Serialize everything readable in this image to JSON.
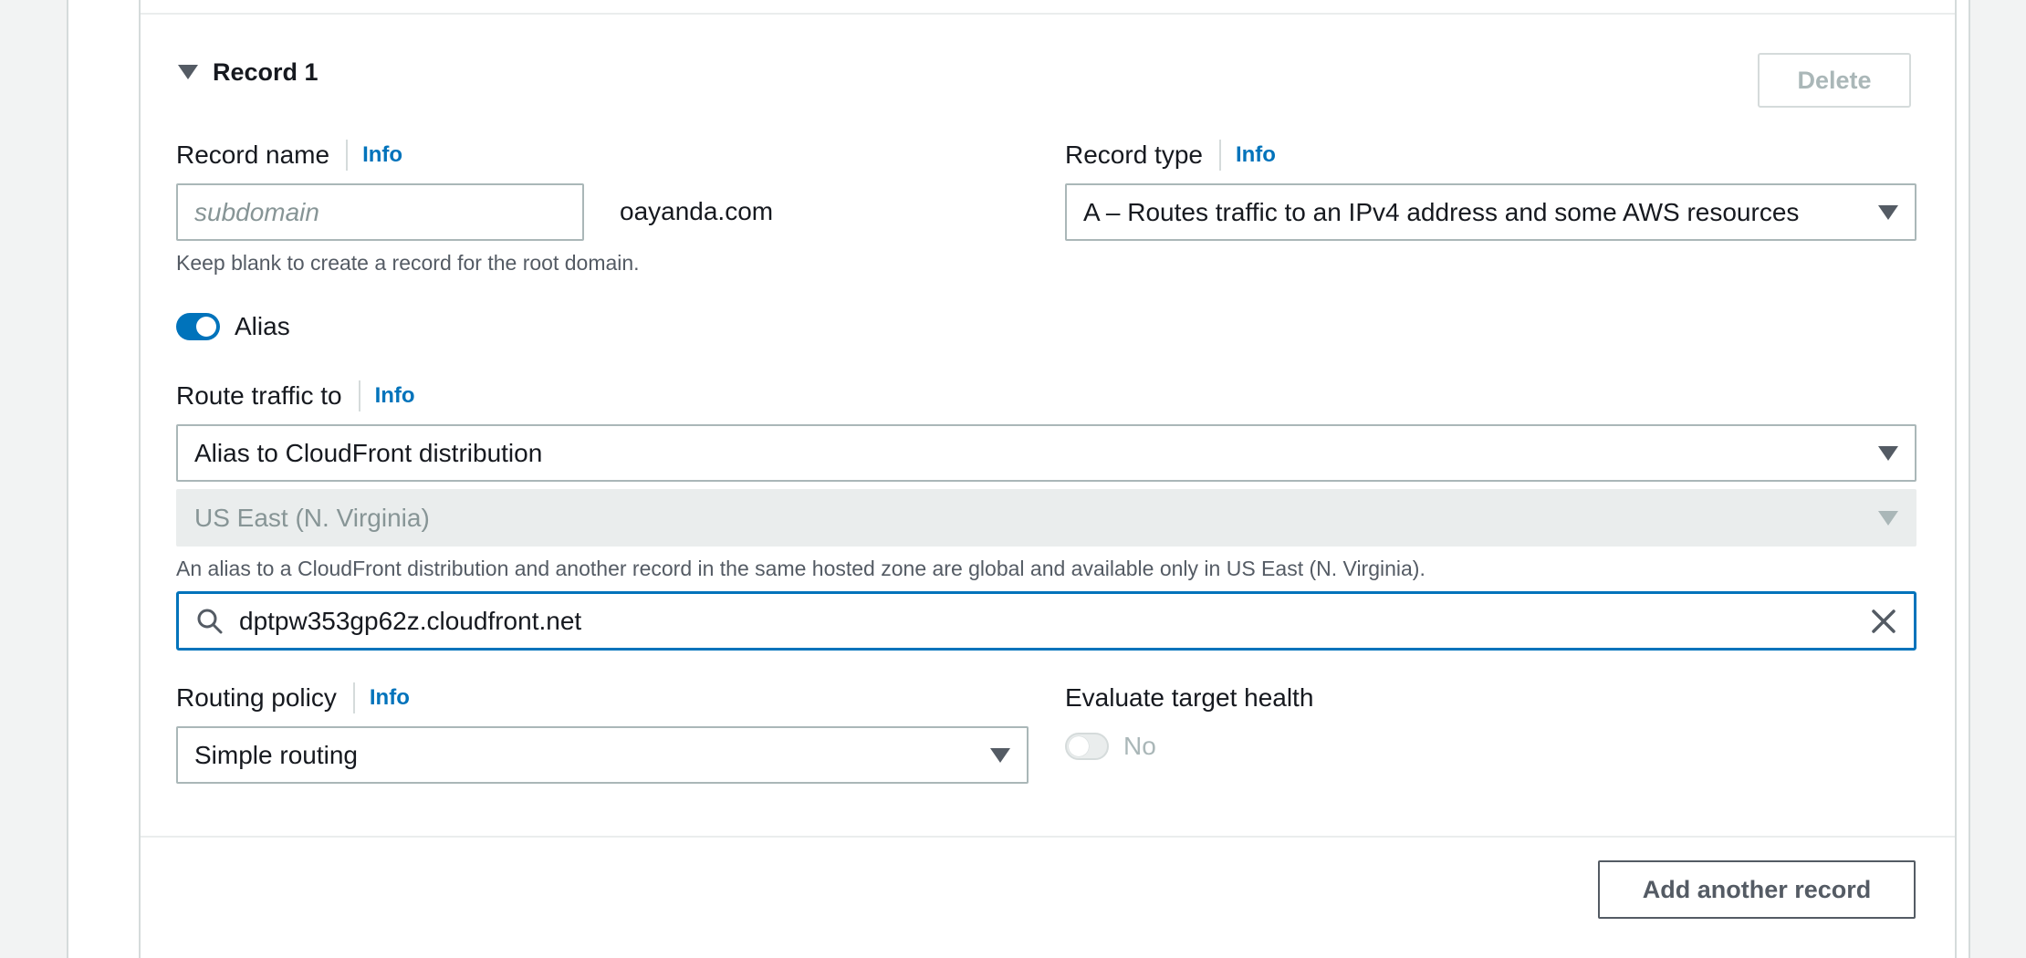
{
  "record": {
    "title": "Record 1",
    "delete_label": "Delete",
    "record_name": {
      "label": "Record name",
      "info": "Info",
      "placeholder": "subdomain",
      "domain_suffix": "oayanda.com",
      "hint": "Keep blank to create a record for the root domain."
    },
    "record_type": {
      "label": "Record type",
      "info": "Info",
      "value": "A – Routes traffic to an IPv4 address and some AWS resources"
    },
    "alias": {
      "label": "Alias",
      "enabled": true
    },
    "route_traffic": {
      "label": "Route traffic to",
      "info": "Info",
      "endpoint_value": "Alias to CloudFront distribution",
      "region_value": "US East (N. Virginia)",
      "hint": "An alias to a CloudFront distribution and another record in the same hosted zone are global and available only in US East (N. Virginia).",
      "search_value": "dptpw353gp62z.cloudfront.net"
    },
    "routing_policy": {
      "label": "Routing policy",
      "info": "Info",
      "value": "Simple routing"
    },
    "evaluate_health": {
      "label": "Evaluate target health",
      "value_label": "No",
      "enabled": false
    }
  },
  "add_record_label": "Add another record",
  "colors": {
    "accent": "#0073bb",
    "text": "#16191f",
    "muted": "#879596"
  }
}
